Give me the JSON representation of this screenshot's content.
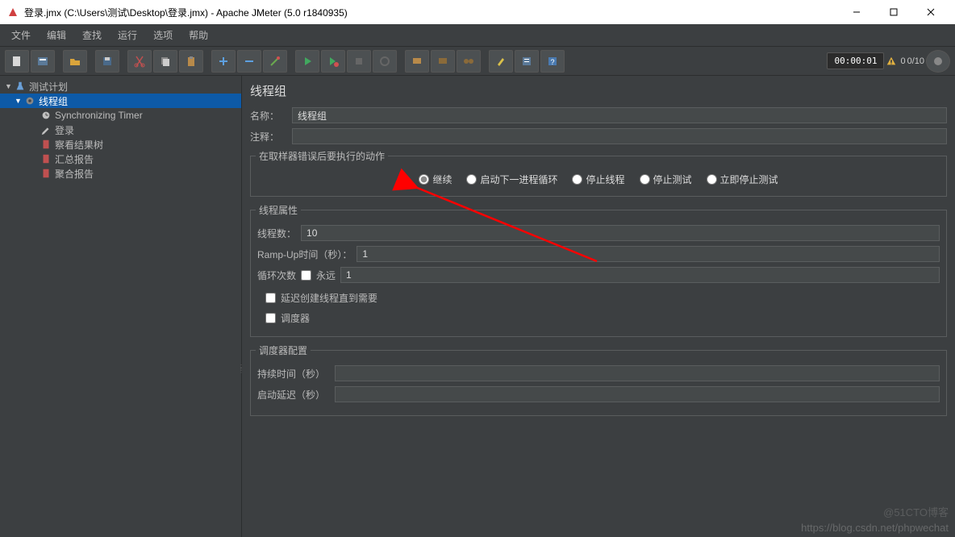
{
  "window": {
    "title": "登录.jmx (C:\\Users\\测试\\Desktop\\登录.jmx) - Apache JMeter (5.0 r1840935)"
  },
  "menu": {
    "items": [
      "文件",
      "编辑",
      "查找",
      "运行",
      "选项",
      "帮助"
    ]
  },
  "status": {
    "timer": "00:00:01",
    "warn_count": "0",
    "threads": "0/10"
  },
  "tree": {
    "items": [
      {
        "label": "测试计划",
        "icon": "flask",
        "indent": 0,
        "expanded": true
      },
      {
        "label": "线程组",
        "icon": "gear",
        "indent": 1,
        "expanded": true,
        "selected": true
      },
      {
        "label": "Synchronizing Timer",
        "icon": "clock",
        "indent": 2
      },
      {
        "label": "登录",
        "icon": "pencil",
        "indent": 2
      },
      {
        "label": "察看结果树",
        "icon": "page-red",
        "indent": 2
      },
      {
        "label": "汇总报告",
        "icon": "page-red",
        "indent": 2
      },
      {
        "label": "聚合报告",
        "icon": "page-red",
        "indent": 2
      }
    ]
  },
  "panel": {
    "title": "线程组",
    "name_label": "名称：",
    "name_value": "线程组",
    "comment_label": "注释：",
    "comment_value": "",
    "error_action": {
      "legend": "在取样器错误后要执行的动作",
      "options": [
        "继续",
        "启动下一进程循环",
        "停止线程",
        "停止测试",
        "立即停止测试"
      ],
      "selected": 0
    },
    "thread_props": {
      "legend": "线程属性",
      "threads_label": "线程数：",
      "threads_value": "10",
      "ramp_label": "Ramp-Up时间（秒）：",
      "ramp_value": "1",
      "loop_label": "循环次数",
      "forever_label": "永远",
      "forever_checked": false,
      "loop_value": "1",
      "delay_create_label": "延迟创建线程直到需要",
      "delay_create_checked": false,
      "scheduler_label": "调度器",
      "scheduler_checked": false
    },
    "scheduler": {
      "legend": "调度器配置",
      "duration_label": "持续时间（秒）",
      "duration_value": "",
      "delay_label": "启动延迟（秒）",
      "delay_value": ""
    }
  },
  "watermark": "https://blog.csdn.net/phpwechat",
  "watermark2": "@51CTO博客"
}
